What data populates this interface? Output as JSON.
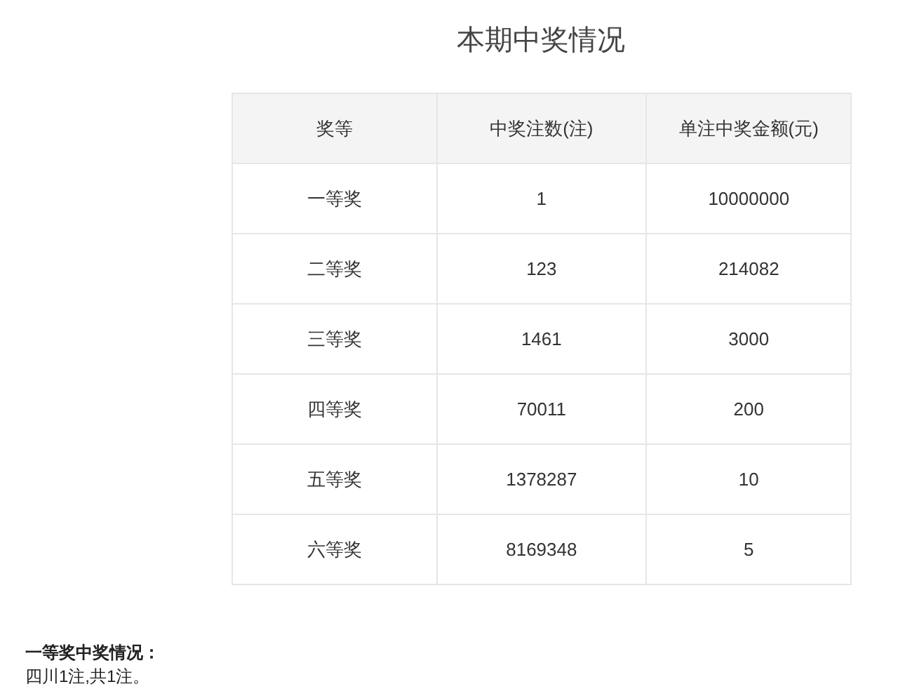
{
  "title": "本期中奖情况",
  "table": {
    "columns": [
      "奖等",
      "中奖注数(注)",
      "单注中奖金额(元)"
    ],
    "rows": [
      [
        "一等奖",
        "1",
        "10000000"
      ],
      [
        "二等奖",
        "123",
        "214082"
      ],
      [
        "三等奖",
        "1461",
        "3000"
      ],
      [
        "四等奖",
        "70011",
        "200"
      ],
      [
        "五等奖",
        "1378287",
        "10"
      ],
      [
        "六等奖",
        "8169348",
        "5"
      ]
    ]
  },
  "first_prize": {
    "heading": "一等奖中奖情况：",
    "detail": "四川1注,共1注。"
  }
}
